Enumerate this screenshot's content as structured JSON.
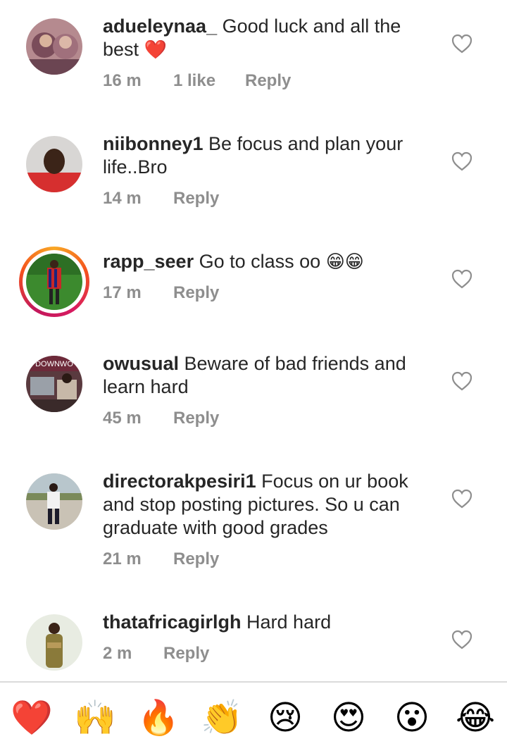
{
  "comments": [
    {
      "username": "adueleynaa_",
      "text": " Good luck and all the best ",
      "emoji": "❤️",
      "time": "16 m",
      "likes": "1 like",
      "reply": "Reply"
    },
    {
      "username": "niibonney1",
      "text": " Be focus and plan your life..Bro",
      "time": "14 m",
      "reply": "Reply"
    },
    {
      "username": "rapp_seer",
      "text": " Go to class oo ",
      "emoji": "😁😁",
      "time": "17 m",
      "reply": "Reply"
    },
    {
      "username": "owusual",
      "text": " Beware of bad friends and learn hard",
      "time": "45 m",
      "reply": "Reply"
    },
    {
      "username": "directorakpesiri1",
      "text": " Focus on ur book and stop posting pictures. So u can graduate with good grades",
      "time": "21 m",
      "reply": "Reply"
    },
    {
      "username": "thatafricagirlgh",
      "text": " Hard hard",
      "time": "2 m",
      "reply": "Reply"
    }
  ],
  "avatar3_text": "DOWNWO",
  "reactions": [
    "❤️",
    "🙌",
    "🔥",
    "👏",
    "😢",
    "😍",
    "😮",
    "😂"
  ],
  "colors": {
    "text": "#262626",
    "meta": "#8e8e8e",
    "divider": "#dbdbdb"
  }
}
